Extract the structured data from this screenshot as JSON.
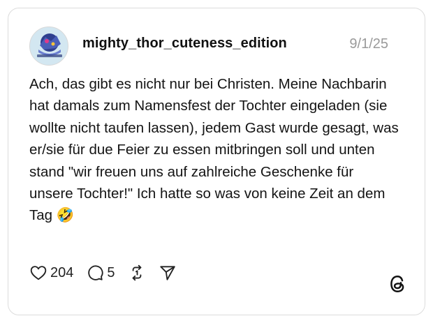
{
  "post": {
    "username": "mighty_thor_cuteness_edition",
    "date": "9/1/25",
    "text": "Ach, das gibt es nicht nur bei Christen. Meine Nachbarin hat damals zum Namensfest der Tochter eingeladen (sie wollte nicht taufen lassen), jedem Gast wurde gesagt, was er/sie für due Feier zu essen mitbringen soll und unten stand \"wir freuen uns auf zahlreiche Geschenke für unsere Tochter!\" Ich hatte so was von keine Zeit an dem Tag 🤣",
    "avatar_icon": "avatar-image"
  },
  "actions": {
    "like_count": "204",
    "reply_count": "5",
    "like_icon": "heart-icon",
    "reply_icon": "comment-bubble-icon",
    "repost_icon": "repost-icon",
    "share_icon": "send-icon"
  },
  "branding": {
    "logo_icon": "threads-logo-icon"
  }
}
